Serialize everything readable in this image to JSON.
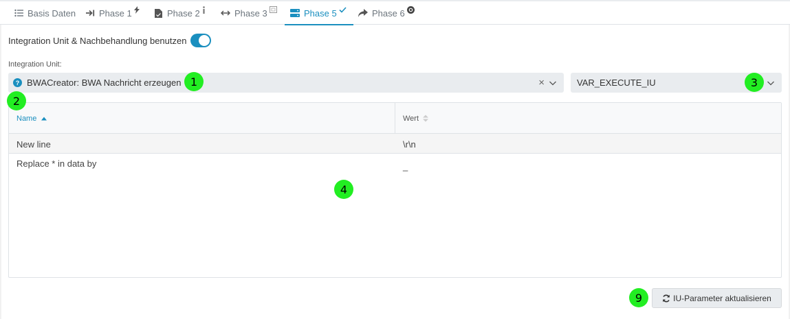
{
  "tabs": [
    {
      "label": "Basis Daten",
      "icon": "list-icon"
    },
    {
      "label": "Phase 1",
      "icon": "arrow-right-bar-icon",
      "sup_icon": "bolt-icon"
    },
    {
      "label": "Phase 2",
      "icon": "file-icon",
      "sup_icon": "info-icon"
    },
    {
      "label": "Phase 3",
      "icon": "arrows-horizontal-icon",
      "sup_icon": "box-icon"
    },
    {
      "label": "Phase 5",
      "icon": "server-icon",
      "sup_icon": "check-icon",
      "active": true
    },
    {
      "label": "Phase 6",
      "icon": "share-arrow-icon",
      "sup_icon": "circle-badge-icon"
    }
  ],
  "toggle": {
    "label": "Integration Unit & Nachbehandlung benutzen",
    "on": true
  },
  "integration_unit": {
    "label": "Integration Unit:",
    "selected": "BWACreator: BWA Nachricht erzeugen",
    "clear": "×"
  },
  "variable_select": {
    "selected": "VAR_EXECUTE_IU"
  },
  "table": {
    "columns": [
      "Name",
      "Wert"
    ],
    "rows": [
      {
        "name": "New line",
        "value": "\\r\\n"
      },
      {
        "name": "Replace * in data by",
        "value": "_"
      }
    ]
  },
  "markers": [
    "1",
    "2",
    "3",
    "4",
    "9"
  ],
  "refresh_button": {
    "label": "IU-Parameter aktualisieren"
  },
  "colors": {
    "accent": "#1a8fbf",
    "marker": "#22ee22",
    "field_bg": "#e9ecef"
  }
}
